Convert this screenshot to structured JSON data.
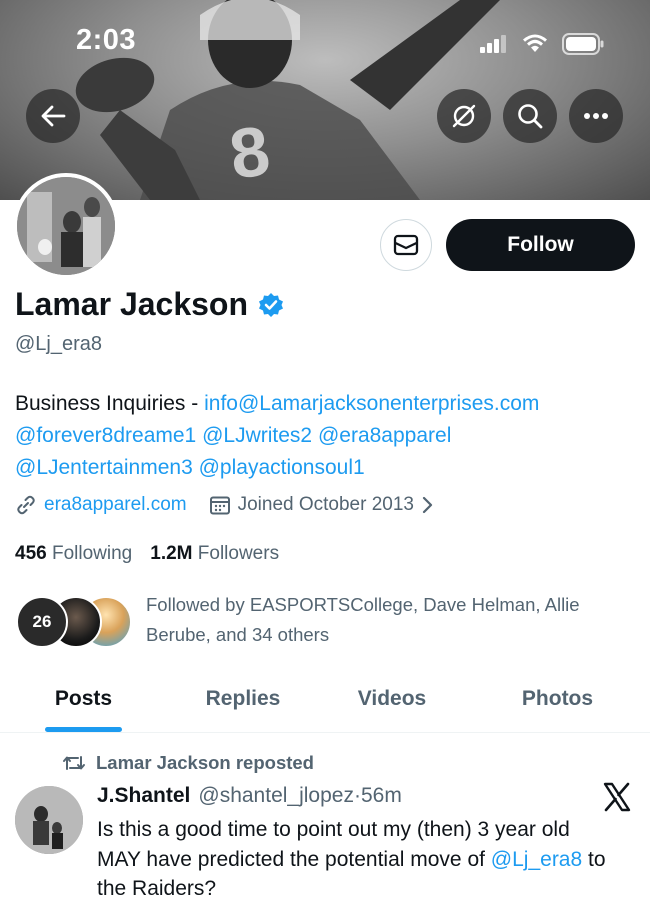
{
  "status_bar": {
    "time": "2:03"
  },
  "header": {
    "back_icon": "arrow-left-icon",
    "actions": [
      "notifications-off-icon",
      "search-icon",
      "more-icon"
    ]
  },
  "profile": {
    "name": "Lamar Jackson",
    "verified_icon": "verified-badge-icon",
    "handle": "@Lj_era8",
    "follow_label": "Follow",
    "bio": {
      "prefix": "Business Inquiries - ",
      "email": "info@Lamarjacksonenterprises.com",
      "mentions_line1": [
        "@forever8dreame1",
        "@LJwrites2",
        "@era8apparel"
      ],
      "mentions_line2": [
        "@LJentertainmen3",
        "@playactionsoul1"
      ]
    },
    "website": "era8apparel.com",
    "joined": "Joined October 2013",
    "following_count": "456",
    "following_label": "Following",
    "followers_count": "1.2M",
    "followers_label": "Followers",
    "followed_by_text": "Followed by EASPORTSCollege, Dave Helman, Allie Berube, and 34 others",
    "college_badge_text": "26"
  },
  "tabs": [
    {
      "label": "Posts",
      "active": true
    },
    {
      "label": "Replies",
      "active": false
    },
    {
      "label": "Videos",
      "active": false
    },
    {
      "label": "Photos",
      "active": false
    }
  ],
  "feed": {
    "repost_label": "Lamar Jackson reposted",
    "post": {
      "author_name": "J.Shantel",
      "author_handle": "@shantel_jlopez",
      "separator": "·",
      "time": "56m",
      "text_before": "Is this a good time to point out my (then) 3 year old MAY have predicted the potential move of ",
      "mention": "@Lj_era8",
      "text_after": " to the Raiders?"
    }
  },
  "colors": {
    "accent": "#1d9bf0",
    "text_primary": "#0f1419",
    "text_secondary": "#536471",
    "follow_bg": "#0f1419"
  }
}
